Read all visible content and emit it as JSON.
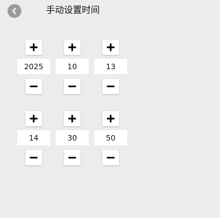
{
  "header": {
    "title": "手动设置时间",
    "back_icon": "chevron-left-icon"
  },
  "date": {
    "year": "2025",
    "month": "10",
    "day": "13"
  },
  "time": {
    "hour": "14",
    "minute": "30",
    "second": "50"
  },
  "icons": {
    "increment": "plus-icon",
    "decrement": "minus-icon"
  },
  "colors": {
    "background": "#ececec",
    "button": "#ffffff",
    "back_button": "#9a9a9a",
    "text": "#111111"
  }
}
